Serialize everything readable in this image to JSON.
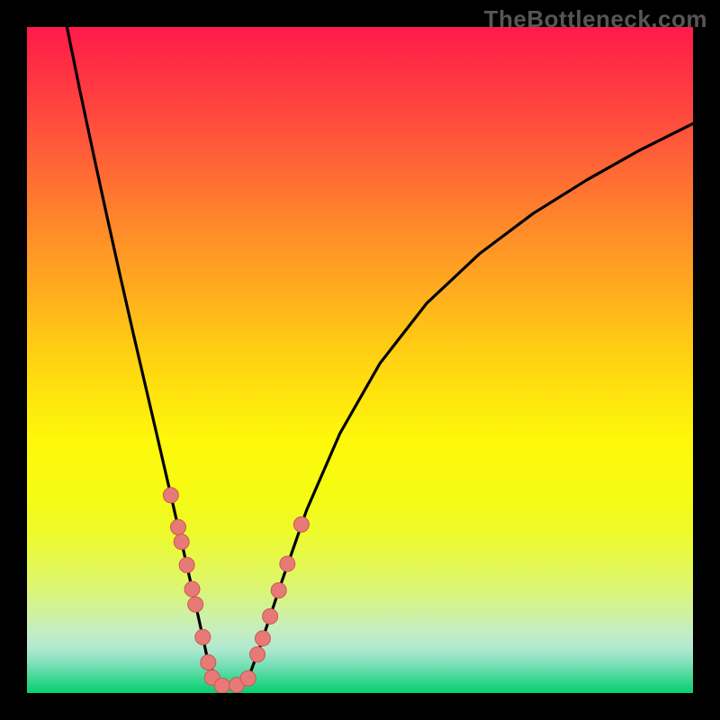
{
  "watermark": "TheBottleneck.com",
  "chart_data": {
    "type": "line",
    "title": "",
    "xlabel": "",
    "ylabel": "",
    "xlim": [
      0,
      100
    ],
    "ylim": [
      0,
      100
    ],
    "grid": false,
    "legend": false,
    "series": [
      {
        "name": "left-branch",
        "stroke": "#000000",
        "x": [
          6,
          8,
          10,
          12,
          14,
          16,
          18,
          20,
          21.6,
          23.2,
          24.8,
          26.4,
          27.2
        ],
        "y": [
          100,
          90.2,
          80.8,
          71.6,
          62.6,
          53.8,
          45.2,
          36.6,
          29.7,
          22.7,
          15.6,
          8.4,
          4.6
        ]
      },
      {
        "name": "bottom-flat",
        "stroke": "#000000",
        "x": [
          27.2,
          29.0,
          31.0,
          33.0
        ],
        "y": [
          4.6,
          1.2,
          1.0,
          1.6
        ]
      },
      {
        "name": "right-branch",
        "stroke": "#000000",
        "x": [
          33.0,
          35.0,
          38.0,
          42.0,
          47.0,
          53.0,
          60.0,
          68.0,
          76.0,
          84.0,
          92.0,
          100.0
        ],
        "y": [
          1.6,
          7.0,
          16.0,
          27.5,
          39.0,
          49.5,
          58.5,
          66.0,
          72.0,
          77.0,
          81.5,
          85.5
        ]
      }
    ],
    "markers": {
      "name": "dot-markers",
      "fill": "#e77a76",
      "stroke": "#c95954",
      "r": 8.5,
      "points": [
        [
          21.6,
          29.7
        ],
        [
          22.7,
          24.9
        ],
        [
          23.2,
          22.7
        ],
        [
          24.0,
          19.2
        ],
        [
          24.8,
          15.6
        ],
        [
          25.3,
          13.3
        ],
        [
          26.4,
          8.4
        ],
        [
          27.2,
          4.6
        ],
        [
          27.8,
          2.3
        ],
        [
          29.3,
          1.1
        ],
        [
          31.5,
          1.2
        ],
        [
          33.2,
          2.2
        ],
        [
          34.6,
          5.8
        ],
        [
          35.4,
          8.2
        ],
        [
          36.5,
          11.5
        ],
        [
          37.8,
          15.4
        ],
        [
          39.1,
          19.4
        ],
        [
          41.2,
          25.3
        ]
      ]
    }
  }
}
